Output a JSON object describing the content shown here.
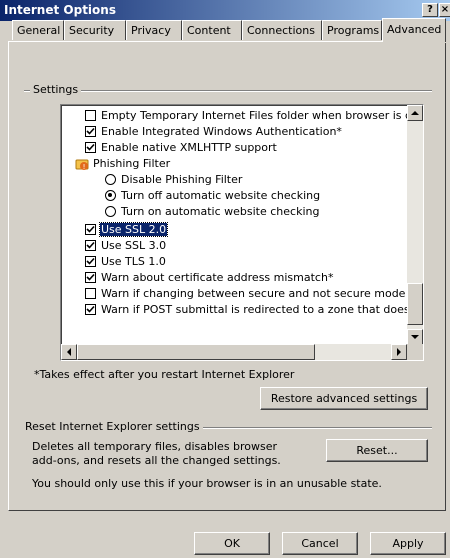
{
  "window": {
    "title": "Internet Options"
  },
  "tabs": [
    {
      "label": "General"
    },
    {
      "label": "Security"
    },
    {
      "label": "Privacy"
    },
    {
      "label": "Content"
    },
    {
      "label": "Connections"
    },
    {
      "label": "Programs"
    },
    {
      "label": "Advanced"
    }
  ],
  "settings": {
    "group_label": "Settings",
    "items": [
      {
        "type": "checkbox",
        "checked": false,
        "label": "Empty Temporary Internet Files folder when browser is clo"
      },
      {
        "type": "checkbox",
        "checked": true,
        "label": "Enable Integrated Windows Authentication*"
      },
      {
        "type": "checkbox",
        "checked": true,
        "label": "Enable native XMLHTTP support"
      },
      {
        "type": "group",
        "icon": "phishing-filter-icon",
        "label": "Phishing Filter"
      },
      {
        "type": "radio",
        "checked": false,
        "label": "Disable Phishing Filter"
      },
      {
        "type": "radio",
        "checked": true,
        "label": "Turn off automatic website checking"
      },
      {
        "type": "radio",
        "checked": false,
        "label": "Turn on automatic website checking"
      },
      {
        "type": "checkbox",
        "checked": true,
        "label": "Use SSL 2.0",
        "selected": true
      },
      {
        "type": "checkbox",
        "checked": true,
        "label": "Use SSL 3.0"
      },
      {
        "type": "checkbox",
        "checked": true,
        "label": "Use TLS 1.0"
      },
      {
        "type": "checkbox",
        "checked": true,
        "label": "Warn about certificate address mismatch*"
      },
      {
        "type": "checkbox",
        "checked": false,
        "label": "Warn if changing between secure and not secure mode"
      },
      {
        "type": "checkbox",
        "checked": true,
        "label": "Warn if POST submittal is redirected to a zone that does n"
      }
    ],
    "footnote": "*Takes effect after you restart Internet Explorer",
    "restore_label": "Restore advanced settings"
  },
  "reset": {
    "group_label": "Reset Internet Explorer settings",
    "description_line1": "Deletes all temporary files, disables browser",
    "description_line2": "add-ons, and resets all the changed settings.",
    "button_label": "Reset...",
    "note": "You should only use this if your browser is in an unusable state."
  },
  "footer": {
    "ok_label": "OK",
    "cancel_label": "Cancel",
    "apply_label": "Apply"
  }
}
